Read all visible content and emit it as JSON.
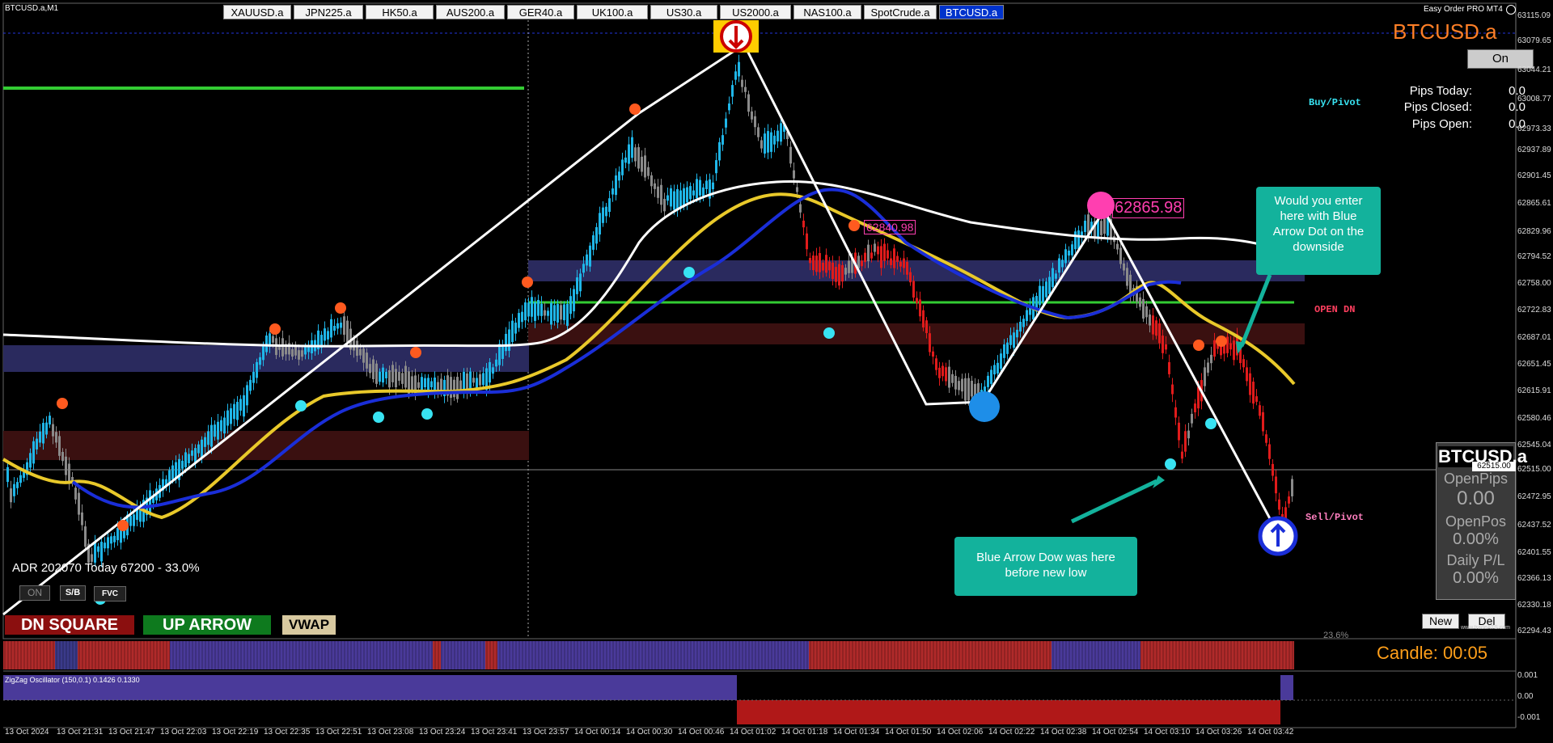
{
  "chart": {
    "title": "BTCUSD.a,M1",
    "symbol_display": "BTCUSD.a",
    "price_scale": [
      "63115.09",
      "63079.65",
      "63044.21",
      "63008.77",
      "62973.33",
      "62937.89",
      "62901.45",
      "62865.61",
      "62829.96",
      "62794.52",
      "62758.00",
      "62722.83",
      "62687.01",
      "62651.45",
      "62615.91",
      "62580.46",
      "62545.04",
      "62515.00",
      "62472.95",
      "62437.52",
      "62401.55",
      "62366.13",
      "62330.18",
      "62294.43",
      "0.001",
      "0.00",
      "-0.001"
    ],
    "time_scale": [
      "13 Oct 2024",
      "13 Oct 21:31",
      "13 Oct 21:47",
      "13 Oct 22:03",
      "13 Oct 22:19",
      "13 Oct 22:35",
      "13 Oct 22:51",
      "13 Oct 23:08",
      "13 Oct 23:24",
      "13 Oct 23:41",
      "13 Oct 23:57",
      "14 Oct 00:14",
      "14 Oct 00:30",
      "14 Oct 00:46",
      "14 Oct 01:02",
      "14 Oct 01:18",
      "14 Oct 01:34",
      "14 Oct 01:50",
      "14 Oct 02:06",
      "14 Oct 02:22",
      "14 Oct 02:38",
      "14 Oct 02:54",
      "14 Oct 03:10",
      "14 Oct 03:26",
      "14 Oct 03:42"
    ],
    "current_price_tag": "62515.00",
    "level_label_1": "62840.98",
    "level_label_2": "62865.98",
    "fib_label": "23.6%",
    "buy_pivot": "Buy/Pivot",
    "sell_pivot": "Sell/Pivot",
    "open_dn": "OPEN DN",
    "adr_text": "ADR 202070   Today 67200 - 33.0%",
    "oscillator_title": "ZigZag Oscillator (150,0.1) 0.1426 0.1330",
    "watermark": "www.tradeATS.com"
  },
  "symbol_tabs": [
    {
      "label": "XAUUSD.a",
      "active": false
    },
    {
      "label": "JPN225.a",
      "active": false
    },
    {
      "label": "HK50.a",
      "active": false
    },
    {
      "label": "AUS200.a",
      "active": false
    },
    {
      "label": "GER40.a",
      "active": false
    },
    {
      "label": "UK100.a",
      "active": false
    },
    {
      "label": "US30.a",
      "active": false
    },
    {
      "label": "US2000.a",
      "active": false
    },
    {
      "label": "NAS100.a",
      "active": false
    },
    {
      "label": "SpotCrude.a",
      "active": false
    },
    {
      "label": "BTCUSD.a",
      "active": true
    }
  ],
  "easy_order": {
    "title": "Easy Order PRO MT4",
    "on_button": "On",
    "pips_today_label": "Pips Today:",
    "pips_today": "0.0",
    "pips_closed_label": "Pips Closed:",
    "pips_closed": "0.0",
    "pips_open_label": "Pips Open:",
    "pips_open": "0.0"
  },
  "info_panel": {
    "symbol": "BTCUSD.a",
    "open_pips_label": "OpenPips",
    "open_pips": "0.00",
    "open_pos_label": "OpenPos",
    "open_pos": "0.00%",
    "daily_pl_label": "Daily P/L",
    "daily_pl": "0.00%"
  },
  "buttons": {
    "new": "New",
    "del": "Del",
    "on": "ON",
    "sb": "S/B",
    "fvc": "FVC"
  },
  "legend_boxes": {
    "dn_square": "DN SQUARE",
    "up_arrow": "UP ARROW",
    "vwap": "VWAP"
  },
  "callouts": {
    "top": "Would you enter here with Blue Arrow Dot on the downside",
    "bottom": "Blue Arrow Dow was here before new low"
  },
  "candle_timer": "Candle:  00:05",
  "colors": {
    "background": "#000000",
    "bull_candle": "#1fb6e8",
    "bear_candle": "#e01b1b",
    "neutral_candle": "#8a8a8a",
    "blue_ma": "#1a2ed8",
    "yellow_ma": "#e9c92a",
    "white_ma": "#ffffff",
    "green_line": "#33cc33",
    "supply_zone": "#3a1010",
    "demand_zone": "#2a2a5e",
    "callout": "#13b29c",
    "orange_dot": "#ff5a1f",
    "cyan_dot": "#38e3f2",
    "magenta_dot": "#ff3fb0"
  }
}
